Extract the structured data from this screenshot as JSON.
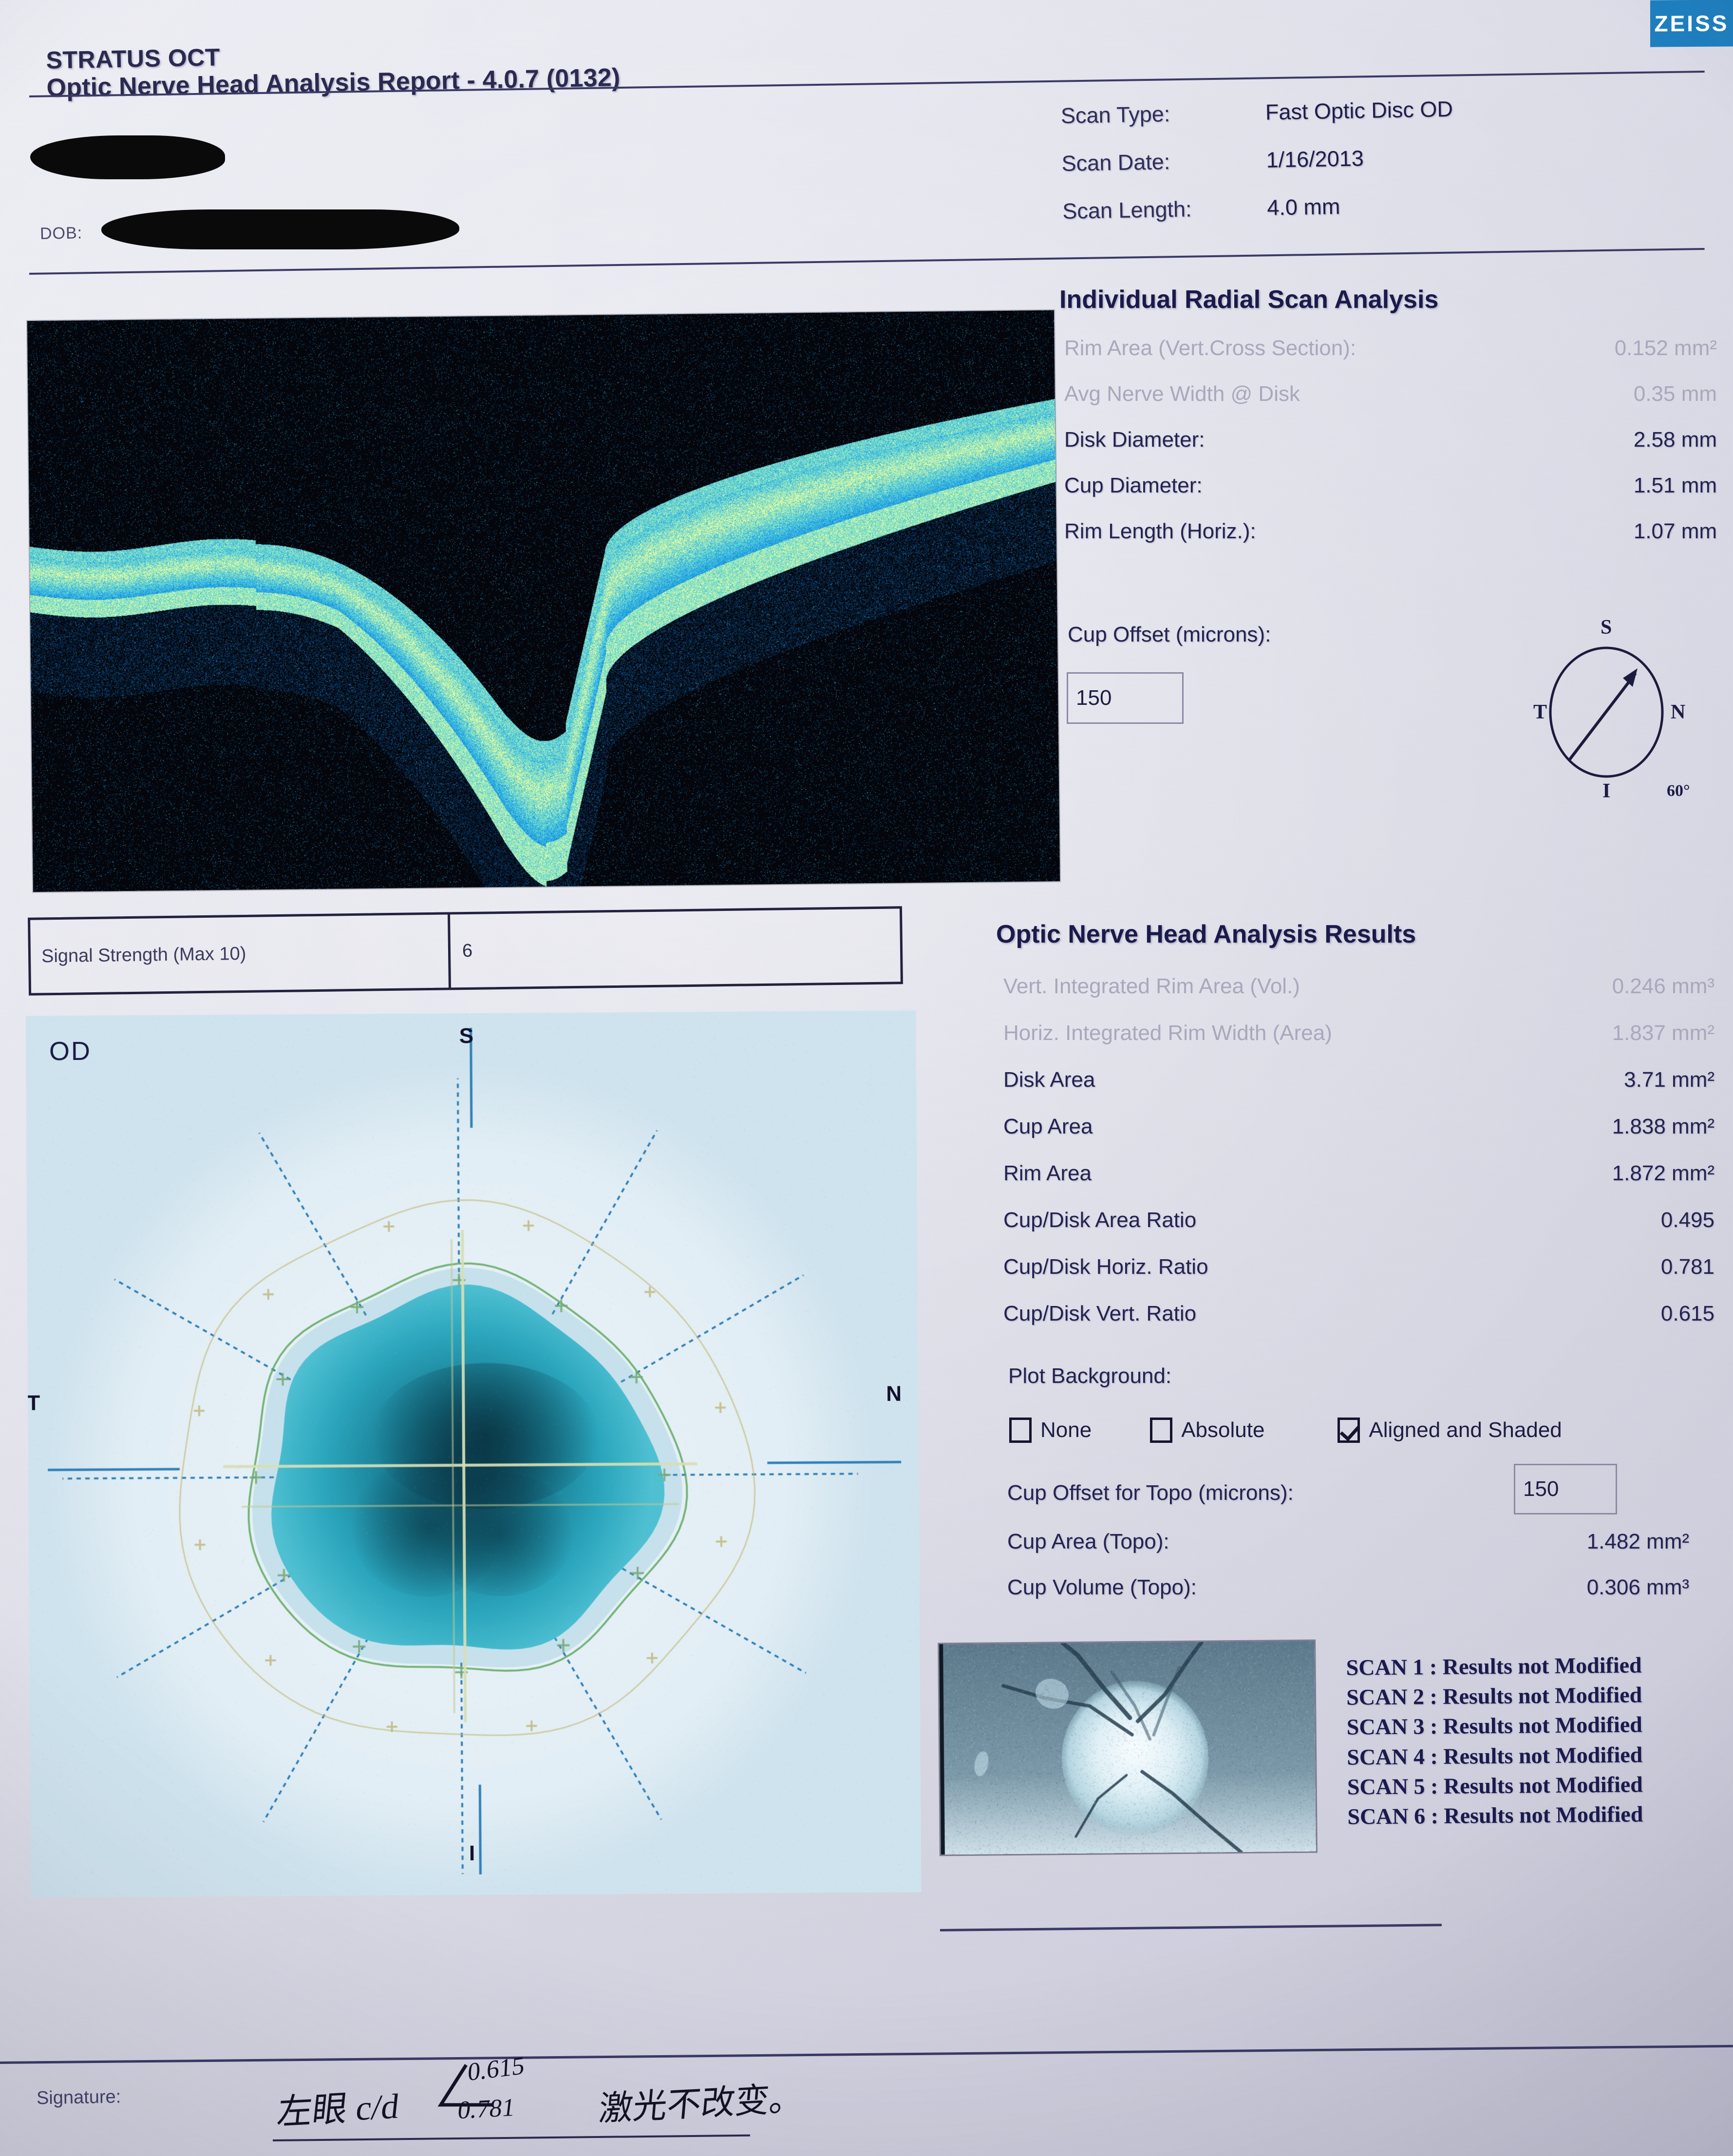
{
  "brand": {
    "logo_text": "ZEISS",
    "logo_color": "#1f7fbf"
  },
  "header": {
    "line1": "STRATUS OCT",
    "line2": "Optic Nerve Head Analysis Report - 4.0.7 (0132)",
    "dob_label": "DOB:"
  },
  "scan_meta": [
    {
      "label": "Scan Type:",
      "value": "Fast Optic Disc  OD"
    },
    {
      "label": "Scan Date:",
      "value": "1/16/2013"
    },
    {
      "label": "Scan Length:",
      "value": "4.0 mm"
    }
  ],
  "radial": {
    "title": "Individual Radial Scan Analysis",
    "rows": [
      {
        "label": "Rim  Area (Vert.Cross Section):",
        "value": "0.152 mm²",
        "faded": true
      },
      {
        "label": "Avg Nerve Width @ Disk",
        "value": "0.35 mm",
        "faded": true
      },
      {
        "label": "Disk Diameter:",
        "value": "2.58 mm",
        "faded": false
      },
      {
        "label": "Cup Diameter:",
        "value": "1.51 mm",
        "faded": false
      },
      {
        "label": "Rim Length (Horiz.):",
        "value": "1.07 mm",
        "faded": false
      }
    ],
    "cup_offset_label": "Cup Offset (microns):",
    "cup_offset_value": "150",
    "compass": {
      "s": "S",
      "n": "N",
      "t": "T",
      "i": "I",
      "angle": "60°"
    }
  },
  "signal_strength": {
    "label": "Signal Strength (Max 10)",
    "value": "6"
  },
  "topo": {
    "eye_label": "OD",
    "ticks": {
      "s": "S",
      "n": "N",
      "t": "T",
      "i": "I"
    }
  },
  "results": {
    "title": "Optic Nerve Head Analysis Results",
    "rows": [
      {
        "label": "Vert. Integrated Rim Area (Vol.)",
        "value": "0.246 mm³",
        "faded": true
      },
      {
        "label": "Horiz. Integrated Rim Width (Area)",
        "value": "1.837 mm²",
        "faded": true
      },
      {
        "label": "Disk Area",
        "value": "3.71 mm²",
        "faded": false
      },
      {
        "label": "Cup Area",
        "value": "1.838 mm²",
        "faded": false
      },
      {
        "label": "Rim Area",
        "value": "1.872 mm²",
        "faded": false
      },
      {
        "label": "Cup/Disk Area Ratio",
        "value": "0.495",
        "faded": false
      },
      {
        "label": "Cup/Disk Horiz. Ratio",
        "value": "0.781",
        "faded": false
      },
      {
        "label": "Cup/Disk Vert. Ratio",
        "value": "0.615",
        "faded": false
      }
    ],
    "plot_background_label": "Plot Background:",
    "plot_background_options": [
      {
        "label": "None",
        "checked": false
      },
      {
        "label": "Absolute",
        "checked": false
      },
      {
        "label": "Aligned and Shaded",
        "checked": true
      }
    ],
    "topo_offset_label": "Cup Offset for Topo (microns):",
    "topo_offset_value": "150",
    "topo_rows": [
      {
        "label": "Cup Area (Topo):",
        "value": "1.482 mm²"
      },
      {
        "label": "Cup Volume (Topo):",
        "value": "0.306 mm³"
      }
    ]
  },
  "scan_status": [
    "SCAN 1 : Results not Modified",
    "SCAN 2 : Results not Modified",
    "SCAN 3 : Results not Modified",
    "SCAN 4 : Results not Modified",
    "SCAN 5 : Results not Modified",
    "SCAN 6 : Results not Modified"
  ],
  "signature": {
    "label": "Signature:",
    "handwriting_main": "左眼 c/d",
    "handwriting_num_top": "0.615",
    "handwriting_num_bottom": "0.781",
    "handwriting_note": "激光不改变。"
  },
  "chart_data": {
    "type": "heatmap",
    "title": "Optic Nerve Head Topography (OD)",
    "annotations": [
      "OD",
      "S",
      "N",
      "T",
      "I"
    ],
    "colormap": "blue-teal shaded topography",
    "disk_area_mm2": 3.71,
    "cup_area_mm2": 1.838,
    "rim_area_mm2": 1.872,
    "cup_disk_area_ratio": 0.495,
    "cup_disk_horiz_ratio": 0.781,
    "cup_disk_vert_ratio": 0.615,
    "radial_scan_count": 6
  }
}
